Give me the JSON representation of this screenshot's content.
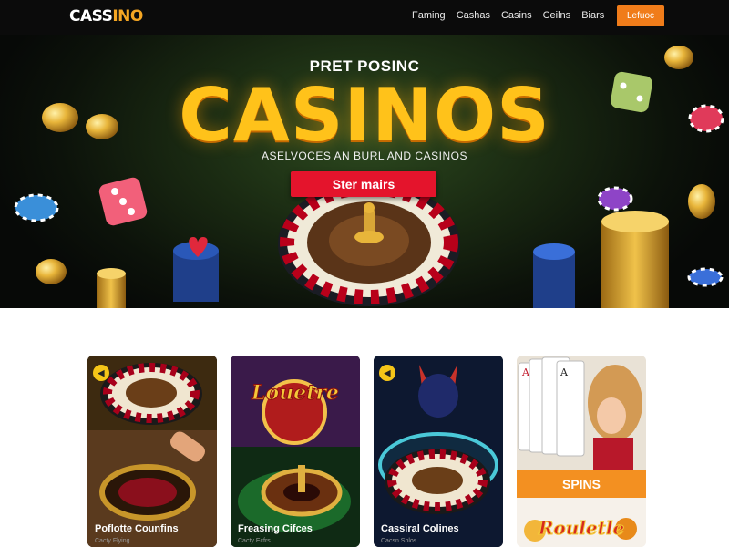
{
  "header": {
    "logo_a": "CASS",
    "logo_b": "INO",
    "nav": [
      "Faming",
      "Cashas",
      "Casins",
      "Ceilns",
      "Biars"
    ],
    "cta_label": "Lefuoc"
  },
  "hero": {
    "kicker": "PRET POSINC",
    "headline": "CASINOS",
    "subline": "ASELVOCES AN BURL AND CASINOS",
    "button_label": "Ster mairs"
  },
  "cards": [
    {
      "title": "Poflotte Counfins",
      "subtitle": "Cacty Flying",
      "badge": "◀"
    },
    {
      "title": "Freasing Cifces",
      "subtitle": "Cacty Ecfrs",
      "sign": "Louetre"
    },
    {
      "title": "Cassiral Colines",
      "subtitle": "Cacsn Sblos",
      "badge": "◀"
    },
    {
      "spins_label": "SPINS",
      "sign": "Rouletle"
    }
  ],
  "colors": {
    "accent": "#f07c1a",
    "hero_button": "#e4142c",
    "headline": "#ffc21a",
    "spins": "#f39021"
  },
  "icons": [
    "roulette-wheel-icon",
    "dice-icon",
    "chip-stack-icon",
    "coin-icon",
    "heart-icon",
    "playing-card-icon"
  ]
}
